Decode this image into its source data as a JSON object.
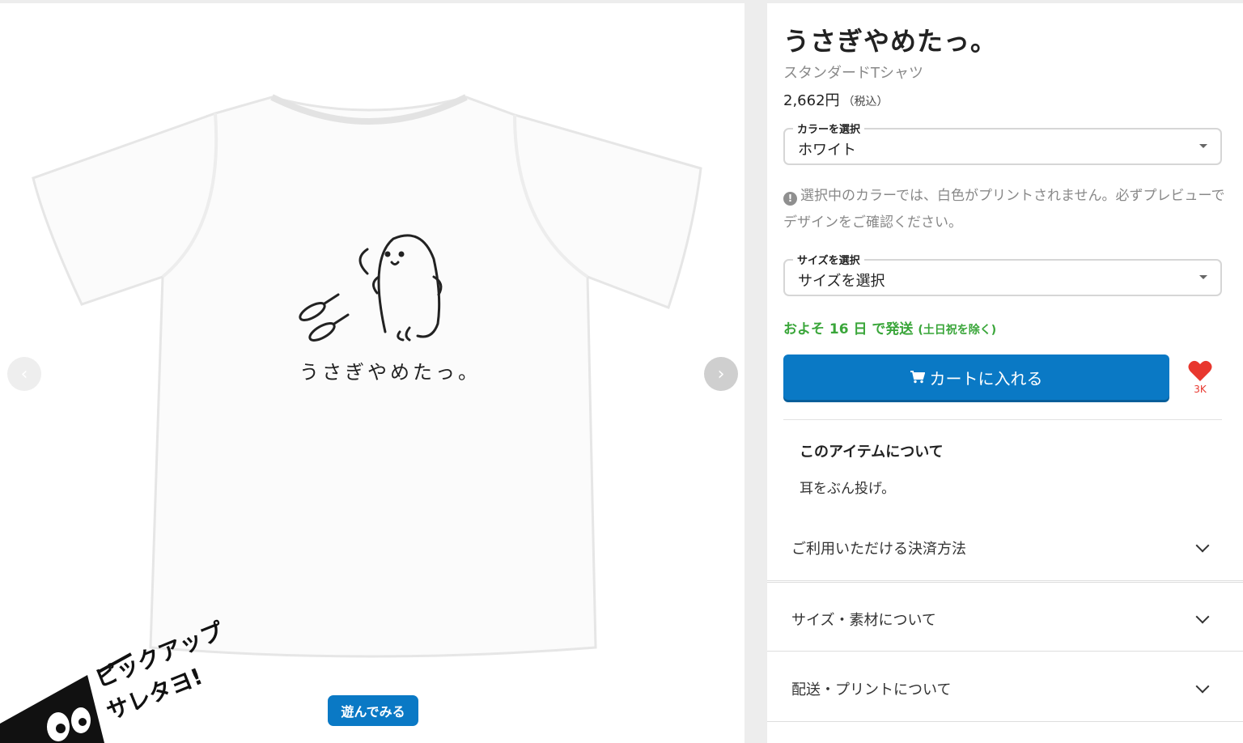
{
  "gallery": {
    "prev_label": "‹",
    "next_label": "›",
    "print_text": "うさぎやめたっ。",
    "play_button": "遊んでみる",
    "pickup_line1": "ピックアップ",
    "pickup_line2": "サレタヨ!"
  },
  "product": {
    "title": "うさぎやめたっ。",
    "type": "スタンダードTシャツ",
    "price": "2,662円",
    "tax_note": "（税込）"
  },
  "color_select": {
    "legend": "カラーを選択",
    "value": "ホワイト"
  },
  "notice": {
    "text": "選択中のカラーでは、白色がプリントされません。必ずプレビューでデザインをご確認ください。"
  },
  "size_select": {
    "legend": "サイズを選択",
    "value": "サイズを選択"
  },
  "shipping": {
    "main": "およそ 16 日 で発送",
    "note": "(土日祝を除く)"
  },
  "cart": {
    "label": "カートに入れる"
  },
  "favorite": {
    "count": "3K"
  },
  "about": {
    "title": "このアイテムについて",
    "text": "耳をぶん投げ。"
  },
  "accordions": [
    {
      "label": "ご利用いただける決済方法"
    },
    {
      "label": "サイズ・素材について"
    },
    {
      "label": "配送・プリントについて"
    }
  ],
  "colors": {
    "primary_button": "#0a79c5",
    "shipping_green": "#3aa63a",
    "heart_red": "#e8372e"
  }
}
